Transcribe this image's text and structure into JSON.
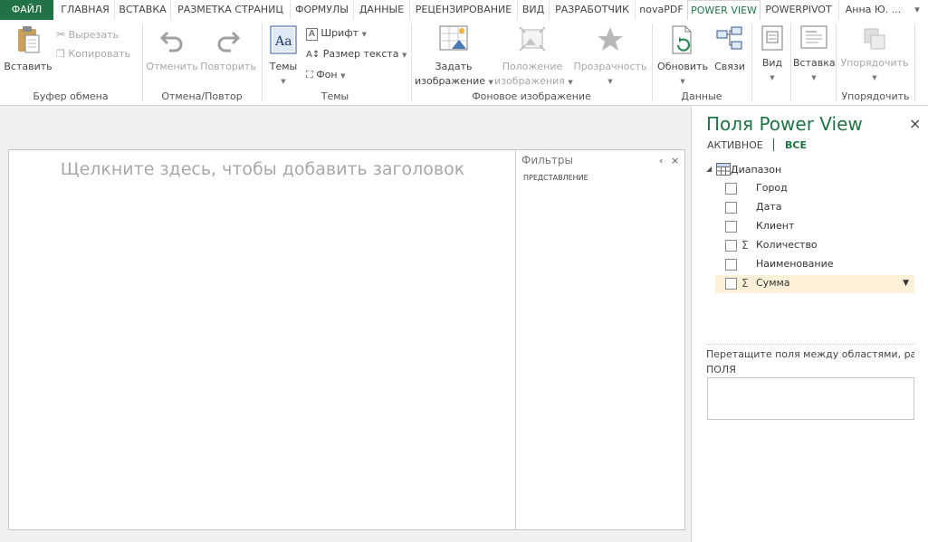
{
  "tabs": [
    {
      "label": "ФАЙЛ"
    },
    {
      "label": "ГЛАВНАЯ"
    },
    {
      "label": "ВСТАВКА"
    },
    {
      "label": "РАЗМЕТКА СТРАНИЦ"
    },
    {
      "label": "ФОРМУЛЫ"
    },
    {
      "label": "ДАННЫЕ"
    },
    {
      "label": "РЕЦЕНЗИРОВАНИЕ"
    },
    {
      "label": "ВИД"
    },
    {
      "label": "РАЗРАБОТЧИК"
    },
    {
      "label": "novaPDF"
    },
    {
      "label": "POWER VIEW"
    },
    {
      "label": "POWERPIVOT"
    }
  ],
  "user": "Анна Ю. ...",
  "ribbon": {
    "clipboard": {
      "paste": "Вставить",
      "cut": "Вырезать",
      "copy": "Копировать",
      "group": "Буфер обмена"
    },
    "undo": {
      "undo": "Отменить",
      "redo": "Повторить",
      "group": "Отмена/Повтор"
    },
    "themes": {
      "themes": "Темы",
      "font": "Шрифт",
      "text_size": "Размер текста",
      "background": "Фон",
      "group": "Темы"
    },
    "bgimage": {
      "set_line1": "Задать",
      "set_line2": "изображение",
      "position_line1": "Положение",
      "position_line2": "изображения",
      "transparency": "Прозрачность",
      "group": "Фоновое изображение"
    },
    "data": {
      "refresh": "Обновить",
      "relations": "Связи",
      "group": "Данные"
    },
    "view": {
      "label": "Вид"
    },
    "insert": {
      "label": "Вставка"
    },
    "arrange": {
      "label": "Упорядочить",
      "group": "Упорядочить"
    }
  },
  "canvas": {
    "title_placeholder": "Щелкните здесь, чтобы добавить заголовок",
    "filters_title": "Фильтры",
    "filters_subtitle": "ПРЕДСТАВЛЕНИЕ",
    "collapse_glyph": "‹",
    "close_glyph": "×"
  },
  "pane": {
    "title": "Поля Power View",
    "close_glyph": "×",
    "tab_active": "АКТИВНОЕ",
    "tab_all": "ВСЕ",
    "table_name": "Диапазон",
    "fields": [
      {
        "name": "Город",
        "sigma": false
      },
      {
        "name": "Дата",
        "sigma": false
      },
      {
        "name": "Клиент",
        "sigma": false
      },
      {
        "name": "Количество",
        "sigma": true
      },
      {
        "name": "Наименование",
        "sigma": false
      },
      {
        "name": "Сумма",
        "sigma": true
      }
    ],
    "sigma_glyph": "Σ",
    "dropdown_glyph": "▼",
    "drop_hint": "Перетащите поля между областями, расположенными ниже:",
    "fields_area_label": "ПОЛЯ"
  },
  "colors": {
    "accent": "#217346",
    "selected_row": "#fdf0d8"
  }
}
